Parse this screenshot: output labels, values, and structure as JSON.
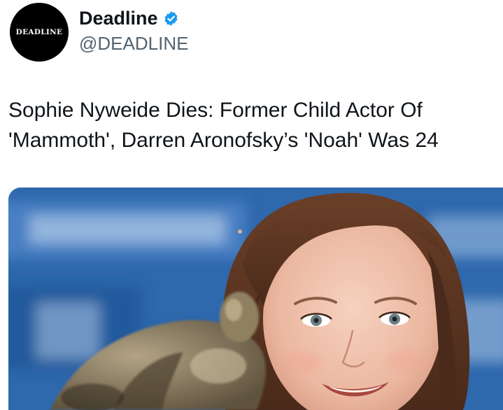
{
  "account": {
    "avatar_text": "DEADLINE",
    "display_name": "Deadline",
    "handle": "@DEADLINE",
    "verified_icon": "verified-badge-icon",
    "verified_color": "#1d9bf0"
  },
  "post": {
    "headline": "Sophie Nyweide Dies: Former Child Actor Of 'Mammoth', Darren Aronofsky’s 'Noah' Was 24"
  },
  "media": {
    "backdrop_color": "#2a64a8"
  }
}
